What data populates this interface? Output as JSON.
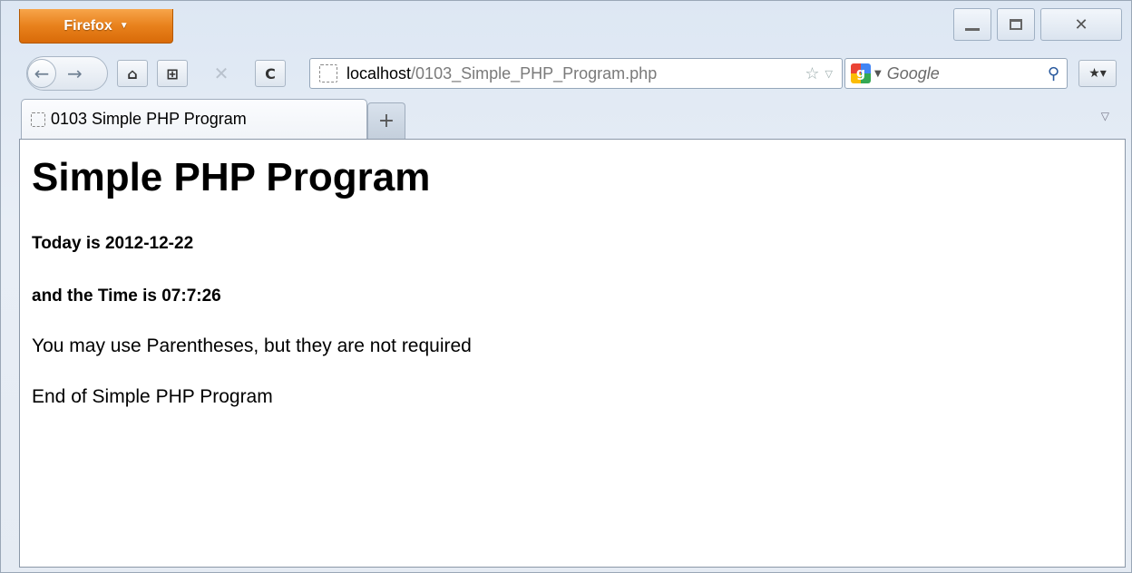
{
  "browser": {
    "app_button_label": "Firefox",
    "url_host": "localhost",
    "url_path": "/0103_Simple_PHP_Program.php",
    "search_engine_placeholder": "Google",
    "tab_title": "0103 Simple PHP Program"
  },
  "icons": {
    "back": "back-arrow-icon",
    "forward": "forward-arrow-icon",
    "home": "home-icon",
    "stop": "stop-icon",
    "reload": "reload-icon",
    "bookmark_star": "star-icon",
    "search": "magnifier-icon"
  },
  "page": {
    "heading": "Simple PHP Program",
    "date_line": "Today is 2012-12-22",
    "time_line": "and the Time is 07:7:26",
    "paragraph_1": "You may use Parentheses, but they are not required",
    "paragraph_2": "End of Simple PHP Program"
  },
  "colors": {
    "firefox_button": "#e8811c",
    "chrome_background": "#dde7f3"
  }
}
